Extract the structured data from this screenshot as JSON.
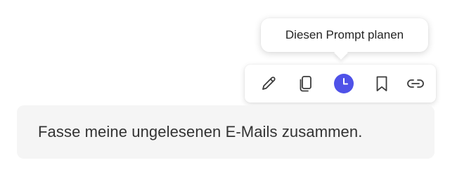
{
  "tooltip": {
    "text": "Diesen Prompt planen"
  },
  "toolbar": {
    "icons": [
      "edit-icon",
      "copy-icon",
      "schedule-clock-icon",
      "bookmark-icon",
      "link-icon"
    ],
    "accent": "#4f52e8",
    "icon_color": "#3c3c3c"
  },
  "message": {
    "text": "Fasse meine ungelesenen E-Mails zusammen."
  }
}
